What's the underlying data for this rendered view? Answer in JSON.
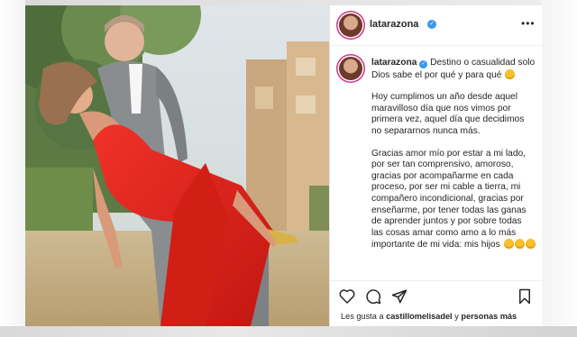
{
  "post": {
    "username": "latarazona",
    "more_label": "•••",
    "caption_user": "latarazona",
    "caption_line1": "Destino o casualidad solo Dios sabe el por qué y para qué",
    "caption_para2": "Hoy cumplimos un año desde aquel maravilloso día que nos vimos por primera vez, aquel día que decidimos no separarnos nunca más.",
    "caption_para3": "Gracias amor mío por estar a mi lado, por ser tan comprensivo, amoroso, gracias por acompañarme en cada proceso, por ser mi cable a tierra, mi compañero incondicional, gracias por enseñarme, por tener todas las ganas de aprender juntos y por sobre todas las cosas amar como amo a lo más importante de mi vida: mis hijos",
    "likes_prefix": "Les gusta a",
    "likes_user": "castillomelisadel",
    "likes_suffix": "y",
    "likes_others": "personas más"
  },
  "icons": {
    "verified": "verified-badge-icon",
    "more": "more-options-icon",
    "like": "heart-icon",
    "comment": "comment-icon",
    "share": "share-icon",
    "save": "bookmark-icon"
  },
  "colors": {
    "dress": "#e2231a",
    "verified": "#3897f0",
    "avatar_ring": "#d3338b"
  }
}
